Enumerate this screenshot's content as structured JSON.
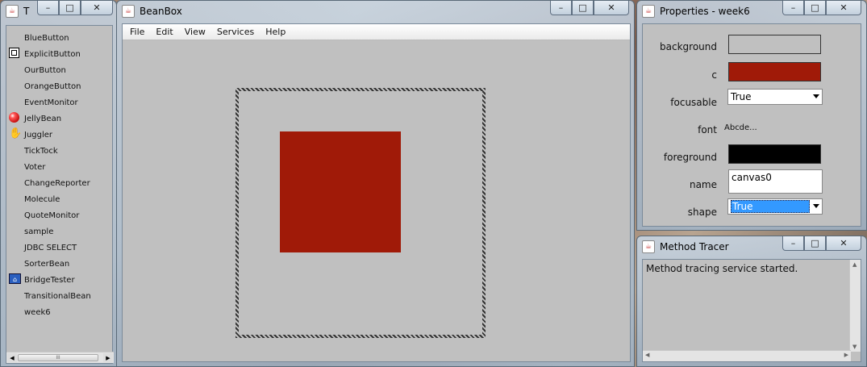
{
  "toolbox": {
    "title": "T",
    "items": [
      {
        "label": "BlueButton",
        "icon": ""
      },
      {
        "label": "ExplicitButton",
        "icon": "explicit-button-icon"
      },
      {
        "label": "OurButton",
        "icon": ""
      },
      {
        "label": "OrangeButton",
        "icon": ""
      },
      {
        "label": "EventMonitor",
        "icon": ""
      },
      {
        "label": "JellyBean",
        "icon": "jellybean-icon"
      },
      {
        "label": "Juggler",
        "icon": "juggler-icon"
      },
      {
        "label": "TickTock",
        "icon": ""
      },
      {
        "label": "Voter",
        "icon": ""
      },
      {
        "label": "ChangeReporter",
        "icon": ""
      },
      {
        "label": "Molecule",
        "icon": ""
      },
      {
        "label": "QuoteMonitor",
        "icon": ""
      },
      {
        "label": "sample",
        "icon": ""
      },
      {
        "label": "JDBC SELECT",
        "icon": ""
      },
      {
        "label": "SorterBean",
        "icon": ""
      },
      {
        "label": "BridgeTester",
        "icon": "bridge-tester-icon"
      },
      {
        "label": "TransitionalBean",
        "icon": ""
      },
      {
        "label": "week6",
        "icon": ""
      }
    ],
    "hscroll_grip": "III"
  },
  "beanbox": {
    "title": "BeanBox",
    "menu": [
      "File",
      "Edit",
      "View",
      "Services",
      "Help"
    ],
    "bean_color": "#a01a08"
  },
  "properties": {
    "title": "Properties - week6",
    "rows": {
      "background": {
        "label": "background",
        "color": "#c0c0c0"
      },
      "c": {
        "label": "c",
        "color": "#a01a08"
      },
      "focusable": {
        "label": "focusable",
        "value": "True"
      },
      "font": {
        "label": "font",
        "value": "Abcde..."
      },
      "foreground": {
        "label": "foreground",
        "color": "#000000"
      },
      "name": {
        "label": "name",
        "value": "canvas0"
      },
      "shape": {
        "label": "shape",
        "value": "True"
      }
    }
  },
  "tracer": {
    "title": "Method Tracer",
    "text": "Method tracing service started."
  },
  "window_buttons": {
    "minimize": "–",
    "maximize": "□",
    "close": "✕"
  }
}
